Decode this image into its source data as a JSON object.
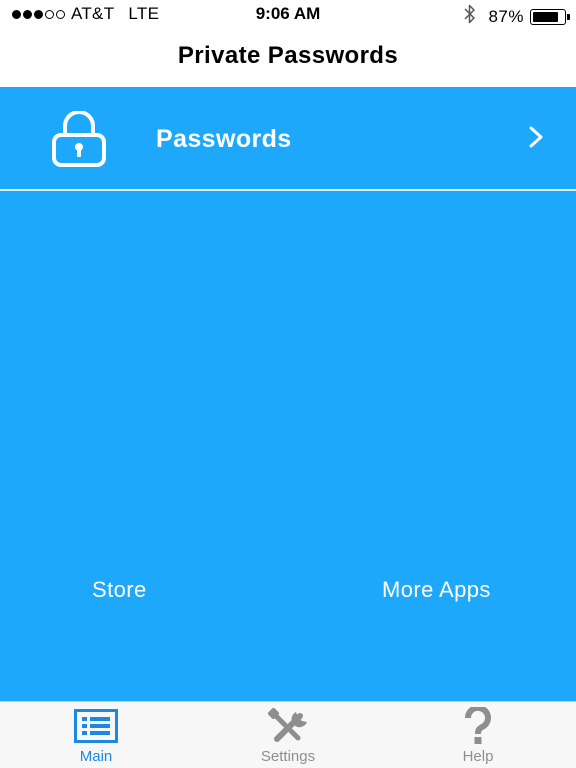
{
  "status_bar": {
    "signal_bars_filled": 3,
    "signal_bars_total": 5,
    "carrier": "AT&T",
    "network": "LTE",
    "time": "9:06 AM",
    "bluetooth_icon": "bluetooth-icon",
    "battery_percent_text": "87%",
    "battery_level": 0.87
  },
  "nav": {
    "title": "Private Passwords"
  },
  "main": {
    "background_color": "#1ea8fb",
    "rows": [
      {
        "icon": "lock-icon",
        "label": "Passwords",
        "accessory": "chevron-right-icon"
      }
    ],
    "links": {
      "store": "Store",
      "more_apps": "More Apps"
    }
  },
  "tab_bar": {
    "active_color": "#1d87e4",
    "inactive_color": "#8e8e8e",
    "tabs": [
      {
        "label": "Main",
        "icon": "list-icon",
        "active": true
      },
      {
        "label": "Settings",
        "icon": "wrench-screwdriver-icon",
        "active": false
      },
      {
        "label": "Help",
        "icon": "question-mark-icon",
        "active": false
      }
    ]
  }
}
